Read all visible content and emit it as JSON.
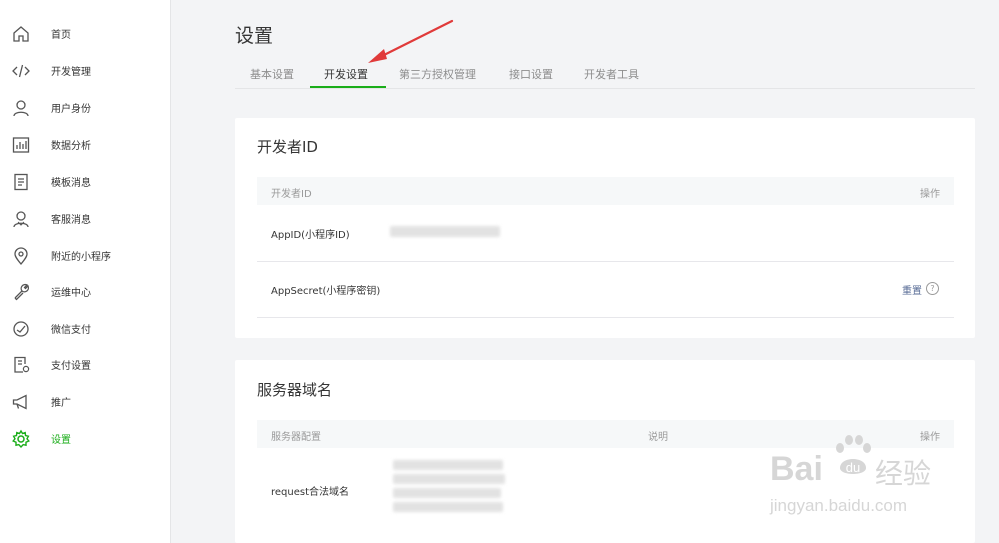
{
  "sidebar": {
    "items": [
      {
        "label": "首页",
        "icon": "home-icon"
      },
      {
        "label": "开发管理",
        "icon": "code-icon"
      },
      {
        "label": "用户身份",
        "icon": "user-icon"
      },
      {
        "label": "数据分析",
        "icon": "chart-icon"
      },
      {
        "label": "模板消息",
        "icon": "document-icon"
      },
      {
        "label": "客服消息",
        "icon": "customer-service-icon"
      },
      {
        "label": "附近的小程序",
        "icon": "location-icon"
      },
      {
        "label": "运维中心",
        "icon": "wrench-icon"
      },
      {
        "label": "微信支付",
        "icon": "gauge-icon"
      },
      {
        "label": "支付设置",
        "icon": "payment-settings-icon"
      },
      {
        "label": "推广",
        "icon": "megaphone-icon"
      },
      {
        "label": "设置",
        "icon": "gear-icon",
        "active": true
      }
    ]
  },
  "page": {
    "title": "设置",
    "tabs": [
      {
        "label": "基本设置"
      },
      {
        "label": "开发设置",
        "active": true
      },
      {
        "label": "第三方授权管理"
      },
      {
        "label": "接口设置"
      },
      {
        "label": "开发者工具"
      }
    ]
  },
  "developer_id": {
    "title": "开发者ID",
    "header": {
      "col1": "开发者ID",
      "col2": "操作"
    },
    "rows": [
      {
        "label": "AppID(小程序ID)"
      },
      {
        "label": "AppSecret(小程序密钥)",
        "action": "重置"
      }
    ]
  },
  "server_domain": {
    "title": "服务器域名",
    "header": {
      "col1": "服务器配置",
      "col2": "说明",
      "col3": "操作"
    },
    "rows": [
      {
        "label": "request合法域名"
      }
    ]
  },
  "watermark": {
    "brand_prefix": "Bai",
    "brand_suffix": "经验",
    "url": "jingyan.baidu.com"
  },
  "colors": {
    "accent": "#1aad19",
    "link": "#576b95",
    "arrow": "#e03a3a"
  }
}
